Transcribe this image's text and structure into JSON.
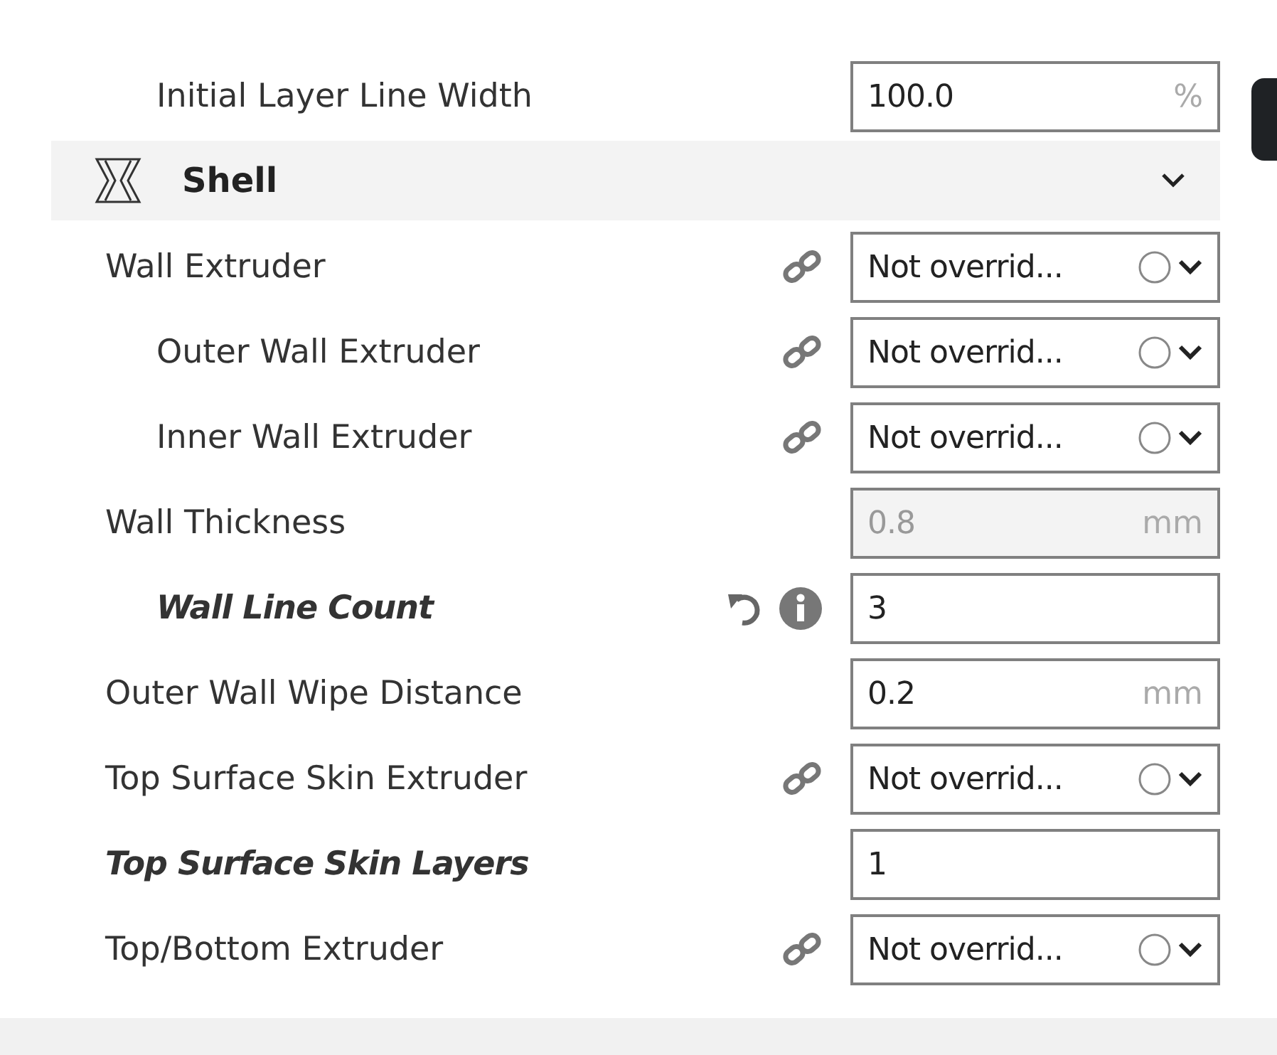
{
  "settings_above": [
    {
      "label": "Initial Layer Line Width",
      "kind": "number",
      "value": "100.0",
      "unit": "%",
      "overridden": false,
      "disabled": false
    }
  ],
  "section": {
    "title": "Shell",
    "expanded": true
  },
  "settings": [
    {
      "label": "Wall Extruder",
      "kind": "dropdown",
      "value": "Not overrid...",
      "overridden": false,
      "linked": true,
      "children": [
        {
          "label": "Outer Wall Extruder",
          "kind": "dropdown",
          "value": "Not overrid...",
          "overridden": false,
          "linked": true
        },
        {
          "label": "Inner Wall Extruder",
          "kind": "dropdown",
          "value": "Not overrid...",
          "overridden": false,
          "linked": true
        }
      ]
    },
    {
      "label": "Wall Thickness",
      "kind": "number",
      "value": "0.8",
      "unit": "mm",
      "overridden": false,
      "disabled": true,
      "children": [
        {
          "label": "Wall Line Count",
          "kind": "number",
          "value": "3",
          "overridden": true,
          "resettable": true,
          "info": true,
          "disabled": false
        }
      ]
    },
    {
      "label": "Outer Wall Wipe Distance",
      "kind": "number",
      "value": "0.2",
      "unit": "mm",
      "overridden": false,
      "disabled": false
    },
    {
      "label": "Top Surface Skin Extruder",
      "kind": "dropdown",
      "value": "Not overrid...",
      "overridden": false,
      "linked": true
    },
    {
      "label": "Top Surface Skin Layers",
      "kind": "number",
      "value": "1",
      "overridden": true,
      "disabled": false
    },
    {
      "label": "Top/Bottom Extruder",
      "kind": "dropdown",
      "value": "Not overrid...",
      "overridden": false,
      "linked": true
    }
  ]
}
